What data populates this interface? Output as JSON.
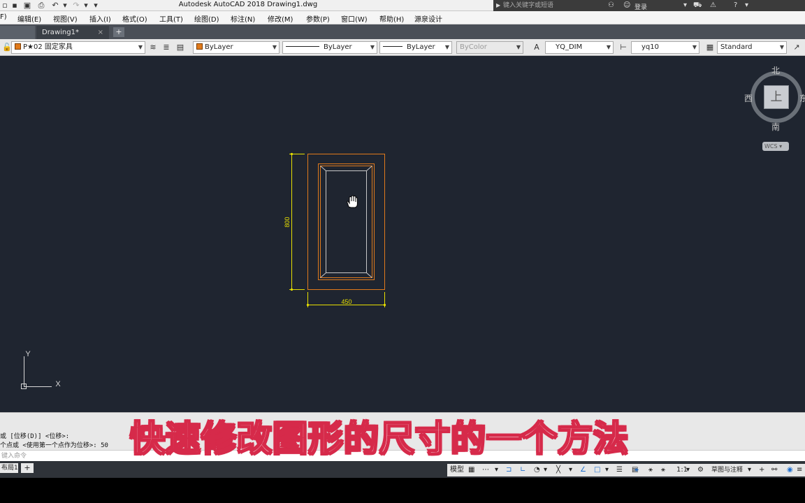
{
  "titlebar": {
    "title": "Autodesk AutoCAD 2018    Drawing1.dwg",
    "search_placeholder": "键入关键字或短语",
    "login_label": "登录"
  },
  "menu": {
    "items": [
      "F)",
      "编辑(E)",
      "视图(V)",
      "插入(I)",
      "格式(O)",
      "工具(T)",
      "绘图(D)",
      "标注(N)",
      "修改(M)",
      "参数(P)",
      "窗口(W)",
      "帮助(H)",
      "源泉设计"
    ]
  },
  "tabs": {
    "drawing": "Drawing1*",
    "close": "×",
    "add": "+"
  },
  "properties": {
    "layer": "P★02 固定家具",
    "color": "ByLayer",
    "linetype": "ByLayer",
    "lineweight": "ByLayer",
    "plotstyle": "ByColor",
    "dimstyle": "YQ_DIM",
    "textstyle": "yq10",
    "tablestyle": "Standard"
  },
  "colors": {
    "canvas_bg": "#1f2530",
    "outline": "#e07a1c",
    "inner_line": "#c8c8c8",
    "dimension": "#e8e000",
    "subtitle_stroke": "#d62a4a"
  },
  "drawing": {
    "width_dim": "450",
    "height_dim": "800"
  },
  "viewcube": {
    "north": "北",
    "south": "南",
    "west": "西",
    "east": "东",
    "face": "上",
    "wcs": "WCS"
  },
  "ucs": {
    "x": "X",
    "y": "Y"
  },
  "subtitle": "快速修改图形的尺寸的一个方法",
  "command": {
    "line1": "或 [位移(D)] <位移>:",
    "line2": "个点或 <使用第一个点作为位移>:  50",
    "input_placeholder": "键入命令"
  },
  "status": {
    "layout_tab": "布局1",
    "add": "+",
    "model": "模型",
    "scale": "1:1",
    "workspace": "草图与注释"
  }
}
